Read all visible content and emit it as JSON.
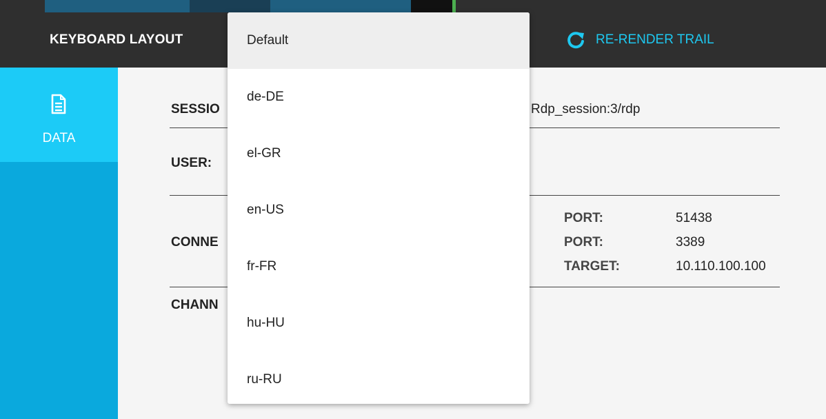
{
  "toolbar": {
    "keyboard_layout_label": "KEYBOARD LAYOUT",
    "rerender_label": "RE-RENDER TRAIL",
    "rerender_icon": "refresh-icon",
    "accent_color": "#1ec8f0"
  },
  "sidebar": {
    "tabs": [
      {
        "label": "DATA",
        "icon": "document-icon"
      }
    ]
  },
  "details": {
    "session_label": "SESSIO",
    "session_value": "Rdp_session:3/rdp",
    "user_label": "USER:",
    "connection_label": "CONNE",
    "connection_fields": [
      {
        "label": "PORT:",
        "value": "51438"
      },
      {
        "label": "PORT:",
        "value": "3389"
      },
      {
        "label": "TARGET:",
        "value": "10.110.100.100"
      }
    ],
    "channels_label": "CHANN"
  },
  "dropdown": {
    "selected": "Default",
    "options": [
      "Default",
      "de-DE",
      "el-GR",
      "en-US",
      "fr-FR",
      "hu-HU",
      "ru-RU"
    ]
  }
}
